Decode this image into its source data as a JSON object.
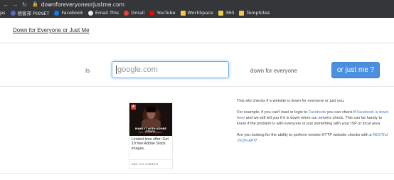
{
  "browser": {
    "url": "downforeveryoneorjustme.com",
    "bookmarks": [
      {
        "label": "ps",
        "icon": "apps-icon",
        "color": "#9aa0a6"
      },
      {
        "label": "痞客邦 PIXNET",
        "icon": "pixnet-icon",
        "color": "#5c6bc0"
      },
      {
        "label": "Facebook",
        "icon": "facebook-icon",
        "color": "#1877f2"
      },
      {
        "label": "Email This",
        "icon": "email-this-icon",
        "color": "#e8eaed"
      },
      {
        "label": "Gmail",
        "icon": "gmail-icon",
        "color": "#ea4335"
      },
      {
        "label": "YouTube",
        "icon": "youtube-icon",
        "color": "#ff0000"
      },
      {
        "label": "WorkSpace",
        "icon": "folder-icon",
        "color": "#f2c94c"
      },
      {
        "label": "360",
        "icon": "folder-icon",
        "color": "#f2c94c"
      },
      {
        "label": "TempSites",
        "icon": "folder-icon",
        "color": "#f2c94c"
      }
    ]
  },
  "header": {
    "site_title": "Down for Everyone or Just Me"
  },
  "check_form": {
    "is_label": "Is",
    "input_placeholder": "google.com",
    "down_label": "down for everyone",
    "button_label": "or just me ?"
  },
  "ad": {
    "badge": "A",
    "image_line1": "MAKE IT WITH ADOBE STOCK.",
    "image_line2": "Get 10 free images ›",
    "text": "Limited time offer: Get 10 free Adobe Stock images.",
    "via": "ADS VIA CARBON"
  },
  "description": {
    "p1": "This site checks if a website is down for everyone or just you.",
    "p2_a": "For example, if you can't load or login to ",
    "p2_link1": "Facebook",
    "p2_b": " you can check if ",
    "p2_link2": "Facebook is down here",
    "p2_c": " and we will tell you if it is down when our servers check. This can be handy to know if the problem is with everyone or just something with your ISP or local area.",
    "p3_a": "Are you looking for the ability to perform remote HTTP website checks with a ",
    "p3_link": "RESTful JSON API",
    "p3_b": "?"
  },
  "colors": {
    "button": "#4a8fe0",
    "link": "#3d7fd0",
    "chrome": "#35363a"
  }
}
